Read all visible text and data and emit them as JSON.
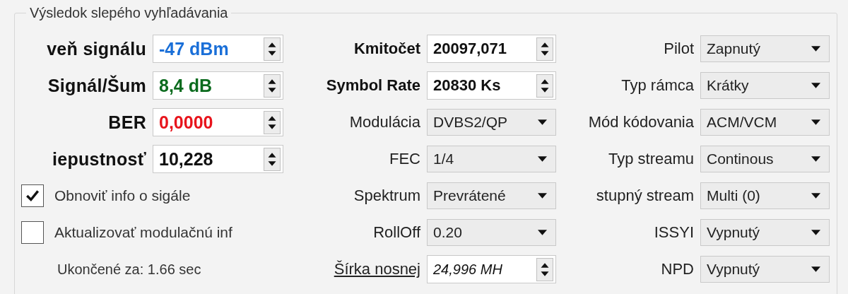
{
  "group": {
    "title": "Výsledok slepého vyhľadávania"
  },
  "signal_fields": [
    {
      "label": "veň signálu",
      "value": "-47 dBm",
      "color": "#1a6fd8"
    },
    {
      "label": "Signál/Šum",
      "value": "8,4 dB",
      "color": "#0b6b1e"
    },
    {
      "label": "BER",
      "value": "0,0000",
      "color": "#e8141c"
    },
    {
      "label": "iepustnosť",
      "value": "10,228",
      "color": "#111111"
    }
  ],
  "checkboxes": [
    {
      "label": "Obnoviť info o sigále",
      "checked": true
    },
    {
      "label": "Aktualizovať modulačnú inf",
      "checked": false
    }
  ],
  "status": "Ukončené za: 1.66 sec",
  "middle": [
    {
      "kind": "spin",
      "label": "Kmitočet",
      "value": "20097,071"
    },
    {
      "kind": "spin",
      "label": "Symbol Rate",
      "value": "20830 Ks"
    },
    {
      "kind": "combo",
      "label": "Modulácia",
      "value": "DVBS2/QP"
    },
    {
      "kind": "combo",
      "label": "FEC",
      "value": "1/4"
    },
    {
      "kind": "combo",
      "label": "Spektrum",
      "value": "Prevrátené"
    },
    {
      "kind": "combo",
      "label": "RollOff",
      "value": "0.20"
    },
    {
      "kind": "link-spin",
      "label": "Šírka nosnej",
      "value": "24,996 MH"
    }
  ],
  "right": [
    {
      "label": "Pilot",
      "value": "Zapnutý"
    },
    {
      "label": "Typ rámca",
      "value": "Krátky"
    },
    {
      "label": "Mód kódovania",
      "value": "ACM/VCM"
    },
    {
      "label": "Typ streamu",
      "value": "Continous"
    },
    {
      "label": "stupný stream",
      "value": "Multi (0)"
    },
    {
      "label": "ISSYI",
      "value": "Vypnutý"
    },
    {
      "label": "NPD",
      "value": "Vypnutý"
    }
  ]
}
